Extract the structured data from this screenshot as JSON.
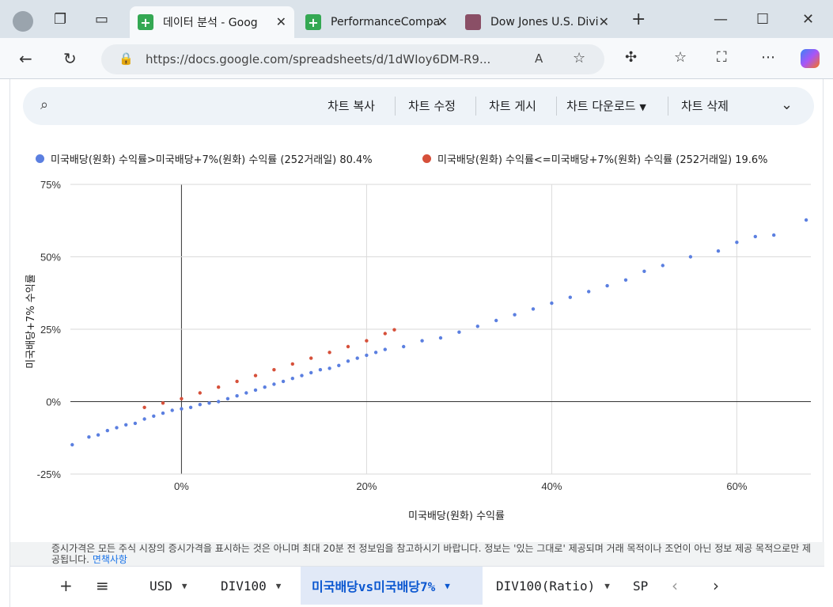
{
  "browser": {
    "tabs": [
      {
        "title": "데이터 분석 - Goog",
        "active": true,
        "favicon_color": "#34a853"
      },
      {
        "title": "PerformanceCompa",
        "active": false,
        "favicon_color": "#34a853"
      },
      {
        "title": "Dow Jones U.S. Divi",
        "active": false,
        "favicon_color": "#8a4f66"
      }
    ],
    "url": "https://docs.google.com/spreadsheets/d/1dWIoy6DM-R9..."
  },
  "chart_toolbar": {
    "items": [
      "차트 복사",
      "차트 수정",
      "차트 게시",
      "차트 다운로드",
      "차트 삭제"
    ]
  },
  "chart_data": {
    "type": "scatter",
    "title": "",
    "xlabel": "미국배당(원화) 수익률",
    "ylabel": "미국배당+7% 수익률",
    "xlim": [
      -0.12,
      0.68
    ],
    "ylim": [
      -0.25,
      0.75
    ],
    "x_ticks": [
      "0%",
      "20%",
      "40%",
      "60%"
    ],
    "y_ticks": [
      "75%",
      "50%",
      "25%",
      "0%",
      "-25%"
    ],
    "grid": true,
    "legend_position": "top",
    "series": [
      {
        "name": "미국배당(원화) 수익률>미국배당+7%(원화) 수익률 (252거래일) 80.4%",
        "color": "#5b7fe0",
        "points": [
          [
            -0.118,
            -0.149
          ],
          [
            -0.1,
            -0.122
          ],
          [
            -0.09,
            -0.115
          ],
          [
            -0.08,
            -0.1
          ],
          [
            -0.07,
            -0.09
          ],
          [
            -0.06,
            -0.08
          ],
          [
            -0.05,
            -0.075
          ],
          [
            -0.04,
            -0.06
          ],
          [
            -0.03,
            -0.05
          ],
          [
            -0.02,
            -0.04
          ],
          [
            -0.01,
            -0.03
          ],
          [
            0.0,
            -0.025
          ],
          [
            0.01,
            -0.02
          ],
          [
            0.02,
            -0.01
          ],
          [
            0.03,
            -0.005
          ],
          [
            0.04,
            0.0
          ],
          [
            0.05,
            0.01
          ],
          [
            0.06,
            0.02
          ],
          [
            0.07,
            0.03
          ],
          [
            0.08,
            0.04
          ],
          [
            0.09,
            0.05
          ],
          [
            0.1,
            0.06
          ],
          [
            0.11,
            0.07
          ],
          [
            0.12,
            0.08
          ],
          [
            0.13,
            0.09
          ],
          [
            0.14,
            0.1
          ],
          [
            0.15,
            0.11
          ],
          [
            0.16,
            0.115
          ],
          [
            0.17,
            0.125
          ],
          [
            0.18,
            0.14
          ],
          [
            0.19,
            0.15
          ],
          [
            0.2,
            0.16
          ],
          [
            0.21,
            0.17
          ],
          [
            0.22,
            0.18
          ],
          [
            0.24,
            0.19
          ],
          [
            0.26,
            0.21
          ],
          [
            0.28,
            0.22
          ],
          [
            0.3,
            0.24
          ],
          [
            0.32,
            0.26
          ],
          [
            0.34,
            0.28
          ],
          [
            0.36,
            0.3
          ],
          [
            0.38,
            0.32
          ],
          [
            0.4,
            0.34
          ],
          [
            0.42,
            0.36
          ],
          [
            0.44,
            0.38
          ],
          [
            0.46,
            0.4
          ],
          [
            0.48,
            0.42
          ],
          [
            0.5,
            0.45
          ],
          [
            0.52,
            0.47
          ],
          [
            0.55,
            0.5
          ],
          [
            0.58,
            0.52
          ],
          [
            0.6,
            0.55
          ],
          [
            0.62,
            0.57
          ],
          [
            0.64,
            0.575
          ],
          [
            0.675,
            0.627
          ]
        ]
      },
      {
        "name": "미국배당(원화) 수익률<=미국배당+7%(원화) 수익률 (252거래일) 19.6%",
        "color": "#d6503a",
        "points": [
          [
            -0.04,
            -0.02
          ],
          [
            -0.02,
            -0.005
          ],
          [
            0.0,
            0.01
          ],
          [
            0.02,
            0.03
          ],
          [
            0.04,
            0.05
          ],
          [
            0.06,
            0.07
          ],
          [
            0.08,
            0.09
          ],
          [
            0.1,
            0.11
          ],
          [
            0.12,
            0.13
          ],
          [
            0.14,
            0.15
          ],
          [
            0.16,
            0.17
          ],
          [
            0.18,
            0.19
          ],
          [
            0.2,
            0.21
          ],
          [
            0.22,
            0.235
          ],
          [
            0.23,
            0.248
          ]
        ]
      }
    ]
  },
  "footer": {
    "note": "증시가격은 모든 주식 시장의 증시가격을 표시하는 것은 아니며 최대 20분 전 정보임을 참고하시기 바랍니다. 정보는 '있는 그대로' 제공되며 거래 목적이나 조언이 아닌 정보 제공 목적으로만 제공됩니다.",
    "link": "면책사항"
  },
  "sheet_tabs": [
    {
      "label": "USD",
      "active": false
    },
    {
      "label": "DIV100",
      "active": false
    },
    {
      "label": "미국배당vs미국배당7%",
      "active": true
    },
    {
      "label": "DIV100(Ratio)",
      "active": false
    },
    {
      "label": "SP",
      "active": false
    }
  ]
}
